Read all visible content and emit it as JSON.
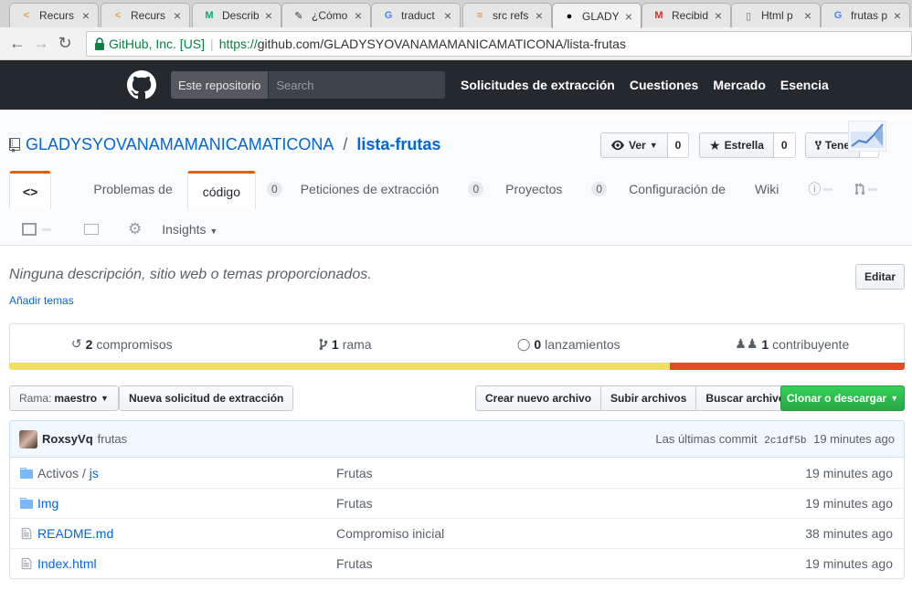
{
  "tabs": [
    {
      "label": "Recurs",
      "icon": "code-icon",
      "color": "#e8a030"
    },
    {
      "label": "Recurs",
      "icon": "code-icon",
      "color": "#e8a030"
    },
    {
      "label": "Describ",
      "icon": "medium-icon",
      "color": "#00ab6c"
    },
    {
      "label": "¿Cómo",
      "icon": "lightbulb-icon",
      "color": "#1f3a1f"
    },
    {
      "label": "traduct",
      "icon": "google-icon",
      "color": "#4285f4"
    },
    {
      "label": "src refs",
      "icon": "stackoverflow-icon",
      "color": "#f48024"
    },
    {
      "label": "GLADY",
      "icon": "github-icon",
      "color": "#000000",
      "active": true
    },
    {
      "label": "Recibid",
      "icon": "gmail-icon",
      "color": "#d93025"
    },
    {
      "label": "Html p",
      "icon": "document-icon",
      "color": "#777777"
    },
    {
      "label": "frutas p",
      "icon": "google-icon",
      "color": "#4285f4"
    }
  ],
  "address": {
    "org": "GitHub, Inc. [US]",
    "https": "https://",
    "rest": "github.com/GLADYSYOVANAMAMANICAMATICONA/lista-frutas"
  },
  "header": {
    "scope": "Este repositorio",
    "search_placeholder": "Search",
    "nav": [
      "Solicitudes de extracción",
      "Cuestiones",
      "Mercado",
      "Esencia"
    ]
  },
  "repo": {
    "owner": "GLADYSYOVANAMAMANICAMATICONA",
    "name": "lista-frutas",
    "watch_label": "Ver",
    "watch_count": "0",
    "star_label": "Estrella",
    "star_count": "0",
    "fork_label": "Tene",
    "fork_count": "0"
  },
  "reponav": {
    "code_glyph": "<>",
    "issues": "Problemas de",
    "code": "código",
    "issues_count": "0",
    "pulls": "Peticiones de extracción",
    "pulls_count": "0",
    "projects": "Proyectos",
    "projects_count": "0",
    "settings": "Configuración de",
    "wiki": "Wiki",
    "insights": "Insights"
  },
  "description": {
    "text": "Ninguna descripción, sitio web o temas proporcionados.",
    "add_topics": "Añadir temas",
    "edit": "Editar"
  },
  "summary": {
    "commits_num": "2",
    "commits_label": "compromisos",
    "branches_num": "1",
    "branches_label": "rama",
    "releases_num": "0",
    "releases_label": "lanzamientos",
    "contributors_num": "1",
    "contributors_label": "contribuyente"
  },
  "languages": [
    {
      "color": "#f1e05a",
      "share": 0.738
    },
    {
      "color": "#e34c26",
      "share": 0.262
    }
  ],
  "filenav": {
    "branch_label": "Rama:",
    "branch_name": "maestro",
    "new_pr": "Nueva solicitud de extracción",
    "create_file": "Crear nuevo archivo",
    "upload": "Subir archivos",
    "find": "Buscar archivo",
    "clone": "Clonar o descargar"
  },
  "commit": {
    "author": "RoxsyVq",
    "message": "frutas",
    "latest_label": "Las últimas commit",
    "sha": "2c1df5b",
    "age": "19 minutes ago"
  },
  "files": [
    {
      "type": "dir",
      "name_prefix": "Activos / ",
      "name": "js",
      "message": "Frutas",
      "age": "19 minutes ago"
    },
    {
      "type": "dir",
      "name_prefix": "",
      "name": "Img",
      "message": "Frutas",
      "age": "19 minutes ago"
    },
    {
      "type": "file",
      "name_prefix": "",
      "name": "README.md",
      "message": "Compromiso inicial",
      "age": "38 minutes ago"
    },
    {
      "type": "file",
      "name_prefix": "",
      "name": "Index.html",
      "message": "Frutas",
      "age": "19 minutes ago"
    }
  ]
}
